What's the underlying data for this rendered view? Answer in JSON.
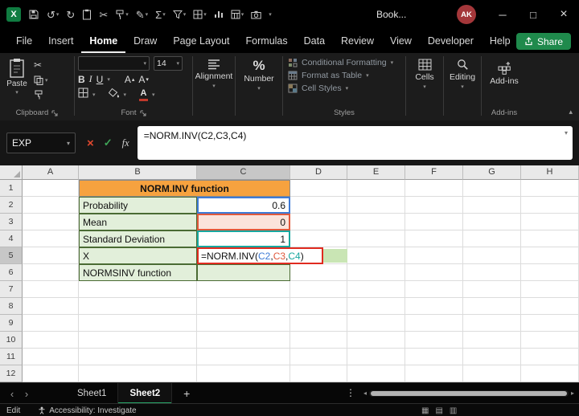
{
  "titlebar": {
    "title": "Book...",
    "avatar": "AK",
    "quick_access": [
      "excel-logo",
      "save",
      "undo",
      "redo",
      "clipboard",
      "cut",
      "format-painter",
      "draw-pen",
      "autosum",
      "filter",
      "borders",
      "chart",
      "table",
      "camera",
      "qat-overflow"
    ],
    "window_controls": [
      "minimize",
      "maximize",
      "close"
    ]
  },
  "menubar": {
    "tabs": [
      {
        "label": "File",
        "active": false
      },
      {
        "label": "Insert",
        "active": false
      },
      {
        "label": "Home",
        "active": true
      },
      {
        "label": "Draw",
        "active": false
      },
      {
        "label": "Page Layout",
        "active": false
      },
      {
        "label": "Formulas",
        "active": false
      },
      {
        "label": "Data",
        "active": false
      },
      {
        "label": "Review",
        "active": false
      },
      {
        "label": "View",
        "active": false
      },
      {
        "label": "Developer",
        "active": false
      },
      {
        "label": "Help",
        "active": false
      }
    ],
    "share_label": "Share",
    "share_color": "#1F8A4C"
  },
  "ribbon": {
    "paste_label": "Paste",
    "clipboard_group": "Clipboard",
    "font_size": "14",
    "bold_label": "B",
    "italic_label": "I",
    "underline_label": "U",
    "font_group": "Font",
    "alignment_label": "Alignment",
    "number_label": "Number",
    "styles": {
      "conditional_formatting": "Conditional Formatting",
      "format_as_table": "Format as Table",
      "cell_styles": "Cell Styles",
      "group": "Styles"
    },
    "cells_label": "Cells",
    "editing_label": "Editing",
    "addins_label": "Add-ins",
    "addins_group": "Add-ins"
  },
  "formula_bar": {
    "name_box": "EXP",
    "fx": "fx",
    "formula": "=NORM.INV(C2,C3,C4)"
  },
  "grid": {
    "columns": [
      "A",
      "B",
      "C",
      "D",
      "E",
      "F",
      "G",
      "H"
    ],
    "rows": [
      "1",
      "2",
      "3",
      "4",
      "5",
      "6",
      "7",
      "8",
      "9",
      "10",
      "11",
      "12"
    ],
    "active_column": "C",
    "active_row": "5",
    "cells": {
      "title": "NORM.INV function",
      "b2": "Probability",
      "c2": "0.6",
      "b3": "Mean",
      "c3": "0",
      "b4": "Standard Deviation",
      "c4": "1",
      "b5": "X",
      "c5": {
        "p0": "=NORM.INV(",
        "r1": "C2",
        "s1": ",",
        "r2": "C3",
        "s2": ",",
        "r3": "C4",
        "p1": ")"
      },
      "b6": "NORMSINV function"
    },
    "colors": {
      "title_fill": "#F6A23F",
      "label_fill": "#E2EFDA",
      "ref1": "#3E7BD6",
      "ref2": "#E0593C",
      "ref3": "#18A79F",
      "annotation_red": "#E02B20"
    }
  },
  "sheet_bar": {
    "tabs": [
      {
        "name": "Sheet1",
        "active": false
      },
      {
        "name": "Sheet2",
        "active": true
      }
    ],
    "add_sheet": "+"
  },
  "status_bar": {
    "mode": "Edit",
    "accessibility": "Accessibility: Investigate"
  }
}
